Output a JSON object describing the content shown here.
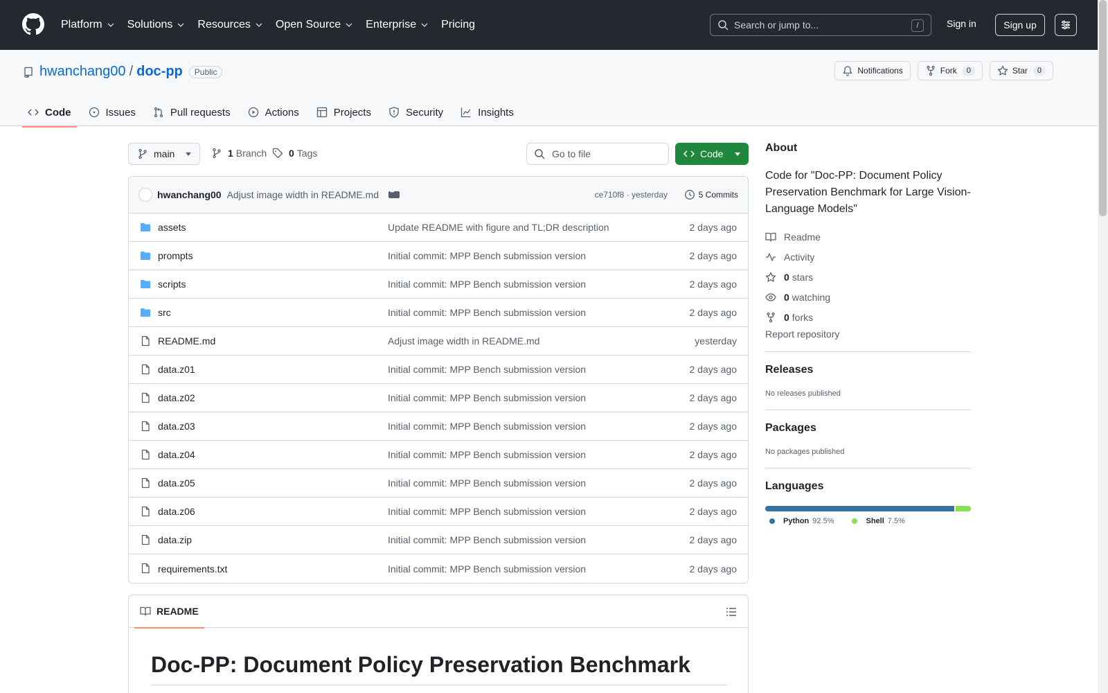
{
  "header": {
    "nav": [
      "Platform",
      "Solutions",
      "Resources",
      "Open Source",
      "Enterprise",
      "Pricing"
    ],
    "search_placeholder": "Search or jump to...",
    "search_shortcut": "/",
    "sign_in": "Sign in",
    "sign_up": "Sign up"
  },
  "repo": {
    "owner": "hwanchang00",
    "separator": "/",
    "name": "doc-pp",
    "visibility": "Public",
    "notifications": "Notifications",
    "fork_label": "Fork",
    "fork_count": "0",
    "star_label": "Star",
    "star_count": "0"
  },
  "tabs": [
    "Code",
    "Issues",
    "Pull requests",
    "Actions",
    "Projects",
    "Security",
    "Insights"
  ],
  "branchbar": {
    "branch": "main",
    "branch_count": "1",
    "branch_label": "Branch",
    "tag_count": "0",
    "tag_label": "Tags",
    "goto_placeholder": "Go to file",
    "code_button": "Code"
  },
  "commit": {
    "author": "hwanchang00",
    "message": "Adjust image width in README.md",
    "hash_and_time": "ce710f8 · yesterday",
    "commits": "5 Commits"
  },
  "files": [
    {
      "name": "assets",
      "type": "dir",
      "message": "Update README with figure and TL;DR description",
      "date": "2 days ago"
    },
    {
      "name": "prompts",
      "type": "dir",
      "message": "Initial commit: MPP Bench submission version",
      "date": "2 days ago"
    },
    {
      "name": "scripts",
      "type": "dir",
      "message": "Initial commit: MPP Bench submission version",
      "date": "2 days ago"
    },
    {
      "name": "src",
      "type": "dir",
      "message": "Initial commit: MPP Bench submission version",
      "date": "2 days ago"
    },
    {
      "name": "README.md",
      "type": "file",
      "message": "Adjust image width in README.md",
      "date": "yesterday"
    },
    {
      "name": "data.z01",
      "type": "file",
      "message": "Initial commit: MPP Bench submission version",
      "date": "2 days ago"
    },
    {
      "name": "data.z02",
      "type": "file",
      "message": "Initial commit: MPP Bench submission version",
      "date": "2 days ago"
    },
    {
      "name": "data.z03",
      "type": "file",
      "message": "Initial commit: MPP Bench submission version",
      "date": "2 days ago"
    },
    {
      "name": "data.z04",
      "type": "file",
      "message": "Initial commit: MPP Bench submission version",
      "date": "2 days ago"
    },
    {
      "name": "data.z05",
      "type": "file",
      "message": "Initial commit: MPP Bench submission version",
      "date": "2 days ago"
    },
    {
      "name": "data.z06",
      "type": "file",
      "message": "Initial commit: MPP Bench submission version",
      "date": "2 days ago"
    },
    {
      "name": "data.zip",
      "type": "file",
      "message": "Initial commit: MPP Bench submission version",
      "date": "2 days ago"
    },
    {
      "name": "requirements.txt",
      "type": "file",
      "message": "Initial commit: MPP Bench submission version",
      "date": "2 days ago"
    }
  ],
  "readme": {
    "tab": "README",
    "title": "Doc-PP: Document Policy Preservation Benchmark"
  },
  "about": {
    "heading": "About",
    "description": "Code for \"Doc-PP: Document Policy Preservation Benchmark for Large Vision-Language Models\"",
    "readme": "Readme",
    "activity": "Activity",
    "stars_count": "0",
    "stars_label": "stars",
    "watching_count": "0",
    "watching_label": "watching",
    "forks_count": "0",
    "forks_label": "forks",
    "report": "Report repository"
  },
  "releases": {
    "heading": "Releases",
    "text": "No releases published"
  },
  "packages": {
    "heading": "Packages",
    "text": "No packages published"
  },
  "languages": {
    "heading": "Languages",
    "items": [
      {
        "name": "Python",
        "percent": "92.5%",
        "value": 92.5,
        "color": "#3572A5"
      },
      {
        "name": "Shell",
        "percent": "7.5%",
        "value": 7.5,
        "color": "#89e051"
      }
    ]
  },
  "colors": {
    "header_bg": "#24292f",
    "link": "#0969da",
    "code_button": "#1f883d",
    "active_tab_underline": "#fd8c73",
    "folder_icon": "#54aeff"
  }
}
